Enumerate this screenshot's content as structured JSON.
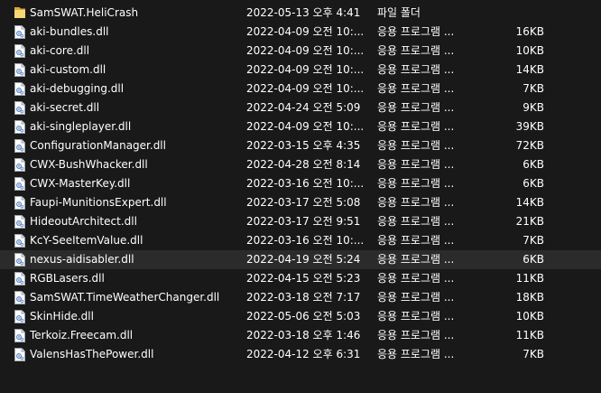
{
  "files": [
    {
      "name": "SamSWAT.HeliCrash",
      "date": "2022-05-13 오후 4:41",
      "type": "파일 폴더",
      "size": "",
      "icon": "folder-icon"
    },
    {
      "name": "aki-bundles.dll",
      "date": "2022-04-09 오전 10:...",
      "type": "응용 프로그램 ...",
      "size": "16KB",
      "icon": "dll-file-icon"
    },
    {
      "name": "aki-core.dll",
      "date": "2022-04-09 오전 10:...",
      "type": "응용 프로그램 ...",
      "size": "10KB",
      "icon": "dll-file-icon"
    },
    {
      "name": "aki-custom.dll",
      "date": "2022-04-09 오전 10:...",
      "type": "응용 프로그램 ...",
      "size": "14KB",
      "icon": "dll-file-icon"
    },
    {
      "name": "aki-debugging.dll",
      "date": "2022-04-09 오전 10:...",
      "type": "응용 프로그램 ...",
      "size": "7KB",
      "icon": "dll-file-icon"
    },
    {
      "name": "aki-secret.dll",
      "date": "2022-04-24 오전 5:09",
      "type": "응용 프로그램 ...",
      "size": "9KB",
      "icon": "dll-file-icon"
    },
    {
      "name": "aki-singleplayer.dll",
      "date": "2022-04-09 오전 10:...",
      "type": "응용 프로그램 ...",
      "size": "39KB",
      "icon": "dll-file-icon"
    },
    {
      "name": "ConfigurationManager.dll",
      "date": "2022-03-15 오후 4:35",
      "type": "응용 프로그램 ...",
      "size": "72KB",
      "icon": "dll-file-icon"
    },
    {
      "name": "CWX-BushWhacker.dll",
      "date": "2022-04-28 오전 8:14",
      "type": "응용 프로그램 ...",
      "size": "6KB",
      "icon": "dll-file-icon"
    },
    {
      "name": "CWX-MasterKey.dll",
      "date": "2022-03-16 오전 10:...",
      "type": "응용 프로그램 ...",
      "size": "6KB",
      "icon": "dll-file-icon"
    },
    {
      "name": "Faupi-MunitionsExpert.dll",
      "date": "2022-03-17 오전 5:08",
      "type": "응용 프로그램 ...",
      "size": "14KB",
      "icon": "dll-file-icon"
    },
    {
      "name": "HideoutArchitect.dll",
      "date": "2022-03-17 오전 9:51",
      "type": "응용 프로그램 ...",
      "size": "21KB",
      "icon": "dll-file-icon"
    },
    {
      "name": "KcY-SeeItemValue.dll",
      "date": "2022-03-16 오전 10:...",
      "type": "응용 프로그램 ...",
      "size": "7KB",
      "icon": "dll-file-icon"
    },
    {
      "name": "nexus-aidisabler.dll",
      "date": "2022-04-19 오전 5:24",
      "type": "응용 프로그램 ...",
      "size": "6KB",
      "icon": "dll-file-icon",
      "selected": true
    },
    {
      "name": "RGBLasers.dll",
      "date": "2022-04-15 오전 5:23",
      "type": "응용 프로그램 ...",
      "size": "11KB",
      "icon": "dll-file-icon"
    },
    {
      "name": "SamSWAT.TimeWeatherChanger.dll",
      "date": "2022-03-18 오전 7:17",
      "type": "응용 프로그램 ...",
      "size": "18KB",
      "icon": "dll-file-icon"
    },
    {
      "name": "SkinHide.dll",
      "date": "2022-05-06 오전 5:03",
      "type": "응용 프로그램 ...",
      "size": "10KB",
      "icon": "dll-file-icon"
    },
    {
      "name": "Terkoiz.Freecam.dll",
      "date": "2022-03-18 오후 1:46",
      "type": "응용 프로그램 ...",
      "size": "11KB",
      "icon": "dll-file-icon"
    },
    {
      "name": "ValensHasThePower.dll",
      "date": "2022-04-12 오후 6:31",
      "type": "응용 프로그램 ...",
      "size": "7KB",
      "icon": "dll-file-icon"
    }
  ]
}
